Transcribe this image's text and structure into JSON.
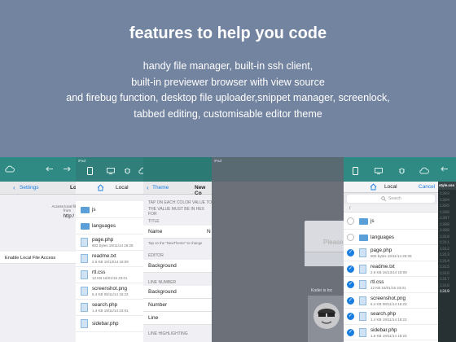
{
  "hero": {
    "title": "features to help you code",
    "lines": [
      "handy file manager, built-in ssh client,",
      "built-in previewer browser with view source",
      "and firebug function, desktop file uploader,snippet manager, screenlock,",
      "tabbed editing, customisable editor theme"
    ]
  },
  "settings_panel": {
    "back_label": "Settings",
    "title_partial": "Lo",
    "note_line1": "Access local fil",
    "note_line2": "from",
    "note_line3": "http:/",
    "option": "Enable Local File Access"
  },
  "files_left": {
    "status": "iPad",
    "title": "Local",
    "items": [
      {
        "name": "js",
        "type": "folder"
      },
      {
        "name": "languages",
        "type": "folder"
      },
      {
        "name": "page.php",
        "meta": "902 bytes 19/11/14 26:28",
        "type": "file"
      },
      {
        "name": "readme.txt",
        "meta": "2.6 KB 16/13/14 18:09",
        "type": "file"
      },
      {
        "name": "rtl.css",
        "meta": "12 KB 16/01/15 23:01",
        "type": "file"
      },
      {
        "name": "screenshot.png",
        "meta": "6.4 KB 08/11/14 16:23",
        "type": "file"
      },
      {
        "name": "search.php",
        "meta": "1.4 KB 19/11/14 23:01",
        "type": "file"
      },
      {
        "name": "sidebar.php",
        "meta": "",
        "type": "file"
      }
    ]
  },
  "theme_panel": {
    "back_label": "Theme",
    "title_partial": "New Co",
    "instructions_1": "TAP ON EACH COLOR VALUE TO",
    "instructions_2": "THE VALUE MUST BE IN HEX FOR",
    "title_section": "TITLE",
    "name_label": "Name",
    "name_value": "N",
    "name_hint": "Tap on the \"NewTheme\" to change",
    "editor_section": "EDITOR",
    "background_1": "Background",
    "line_number_section": "LINE NUMBER",
    "background_2": "Background",
    "number": "Number",
    "line": "Line",
    "line_highlighting_section": "LINE HIGHLIGHTING"
  },
  "dialog_panel": {
    "status": "iPad",
    "placeholder": "Please",
    "locked_text": "Koder is loc"
  },
  "files_right": {
    "title": "Local",
    "cancel": "Cancel",
    "search_placeholder": "Search",
    "path": "/",
    "items": [
      {
        "name": "js",
        "type": "folder",
        "checked": false
      },
      {
        "name": "languages",
        "type": "folder",
        "checked": false
      },
      {
        "name": "page.php",
        "meta": "902 bytes 19/11/14 26:28",
        "type": "file",
        "checked": true
      },
      {
        "name": "readme.txt",
        "meta": "2.6 KB 16/13/14 18:09",
        "type": "file",
        "checked": true
      },
      {
        "name": "rtl.css",
        "meta": "12 KB 16/01/15 23:01",
        "type": "file",
        "checked": true
      },
      {
        "name": "screenshot.png",
        "meta": "6.4 KB 08/11/14 16:23",
        "type": "file",
        "checked": true
      },
      {
        "name": "search.php",
        "meta": "1.4 KB 19/11/14 18:23",
        "type": "file",
        "checked": true
      },
      {
        "name": "sidebar.php",
        "meta": "1.6 KB 19/11/14 18:23",
        "type": "file",
        "checked": true
      }
    ]
  },
  "code_panel": {
    "tab": "style.css",
    "line_numbers": [
      "1303",
      "1304",
      "1305",
      "1306",
      "1307",
      "1308",
      "1309",
      "1310",
      "1311",
      "1312",
      "1313",
      "1314",
      "1315",
      "1316",
      "1317",
      "1318",
      "1319"
    ],
    "highlight_line": "1319"
  },
  "colors": {
    "background": "#7384a0",
    "teal": "#2e8a82",
    "accent": "#1a7ee0"
  }
}
